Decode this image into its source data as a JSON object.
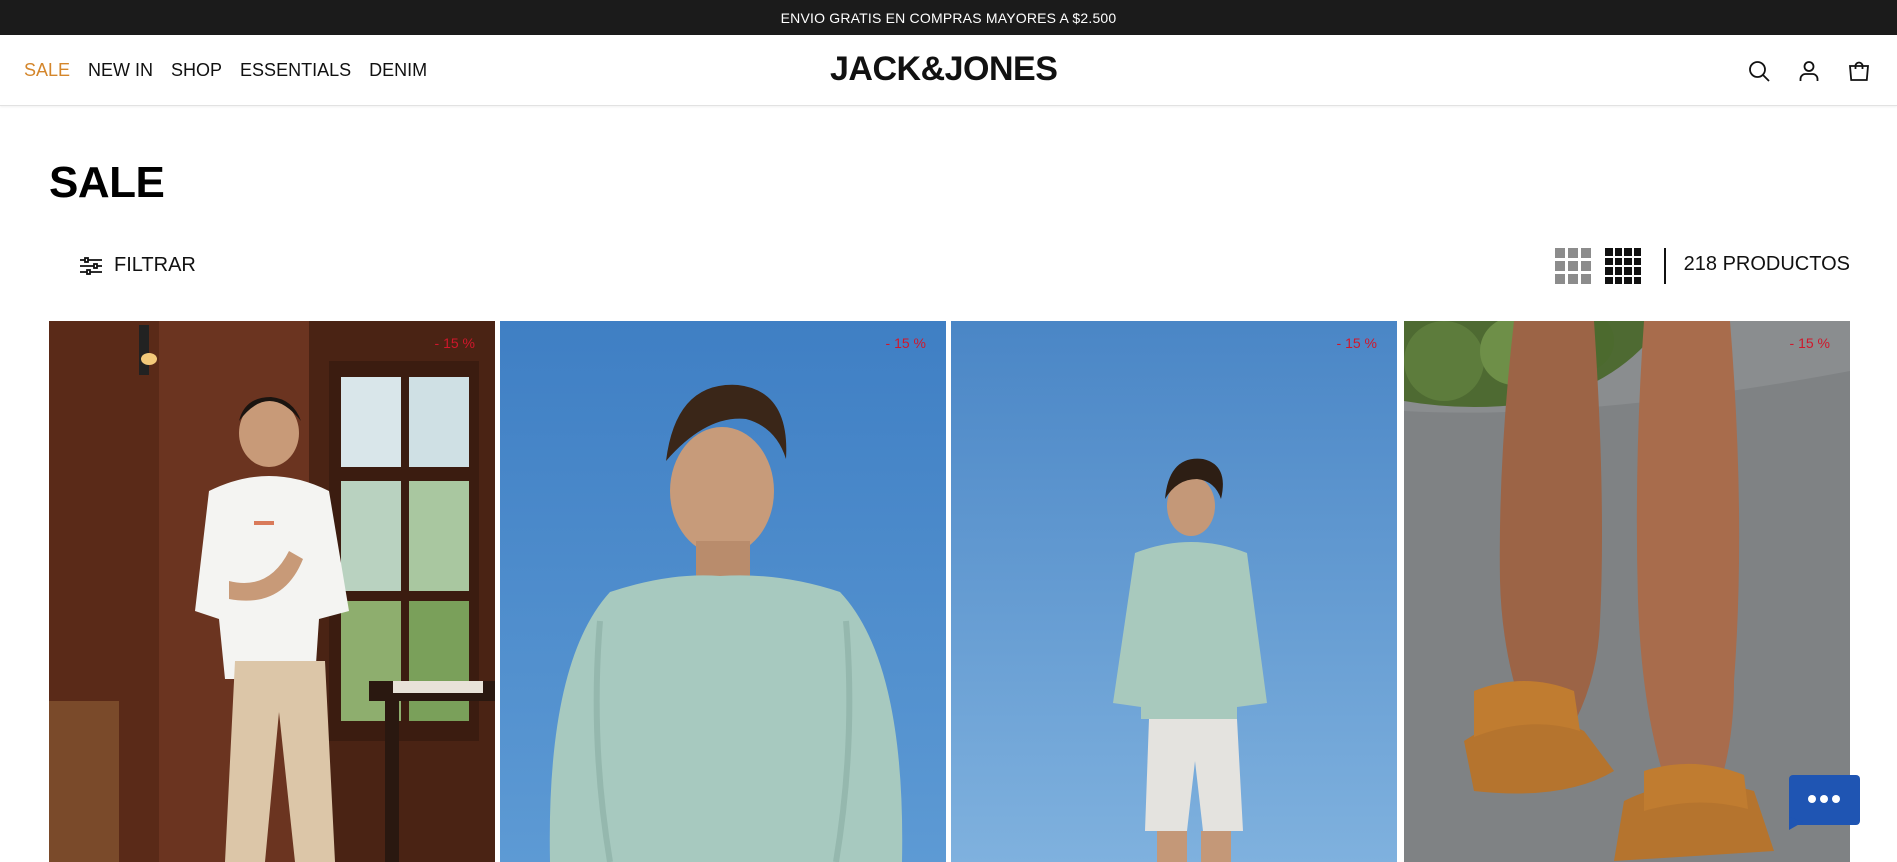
{
  "promo": {
    "text": "ENVIO GRATIS EN COMPRAS MAYORES A $2.500"
  },
  "header": {
    "logo": "JACK&JONES",
    "nav": [
      {
        "label": "SALE"
      },
      {
        "label": "NEW IN"
      },
      {
        "label": "SHOP"
      },
      {
        "label": "ESSENTIALS"
      },
      {
        "label": "DENIM"
      }
    ],
    "icons": [
      "search-icon",
      "account-icon",
      "cart-icon"
    ]
  },
  "page": {
    "title": "SALE"
  },
  "toolbar": {
    "filter_label": "FILTRAR",
    "product_count": "218 PRODUCTOS",
    "view_options": [
      "grid-3-icon",
      "grid-4-icon"
    ],
    "active_view": "grid-4"
  },
  "products": [
    {
      "discount": "- 15 %"
    },
    {
      "discount": "- 15 %"
    },
    {
      "discount": "- 15 %"
    },
    {
      "discount": "- 15 %"
    }
  ],
  "colors": {
    "accent_sale": "#d4862b",
    "discount_red": "#d0172b",
    "promo_bg": "#1b1b1b",
    "chat_bg": "#1f55b3"
  }
}
